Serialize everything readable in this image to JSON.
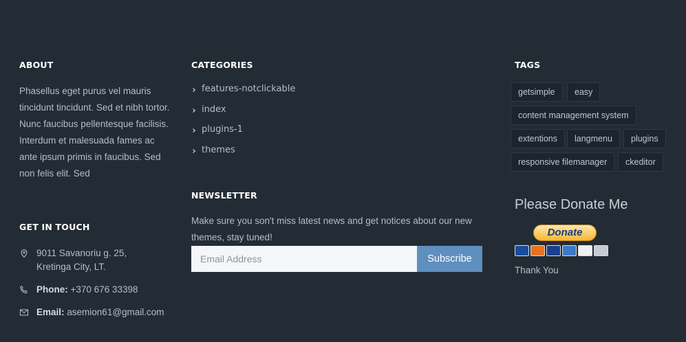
{
  "about": {
    "heading": "ABOUT",
    "text": "Phasellus eget purus vel mauris tincidunt tincidunt. Sed et nibh tortor. Nunc faucibus pellentesque facilisis. Interdum et malesuada fames ac ante ipsum primis in faucibus. Sed non felis elit. Sed"
  },
  "contact": {
    "heading": "GET IN TOUCH",
    "address_line1": "9011 Savanoriu g. 25,",
    "address_line2": "Kretinga City, LT.",
    "phone_label": "Phone:",
    "phone_value": "+370 676 33398",
    "email_label": "Email:",
    "email_value": "asemion61@gmail.com",
    "icons": [
      "map-pin-icon",
      "phone-icon",
      "envelope-icon"
    ]
  },
  "categories": {
    "heading": "CATEGORIES",
    "items": [
      {
        "label": "features-notclickable"
      },
      {
        "label": "index"
      },
      {
        "label": "plugins-1"
      },
      {
        "label": "themes"
      }
    ]
  },
  "newsletter": {
    "heading": "NEWSLETTER",
    "text": "Make sure you son't miss latest news and get notices about our new themes, stay tuned!",
    "input_placeholder": "Email Address",
    "input_value": "",
    "button_label": "Subscribe"
  },
  "tags": {
    "heading": "TAGS",
    "items": [
      {
        "label": "getsimple"
      },
      {
        "label": "easy"
      },
      {
        "label": "content management system"
      },
      {
        "label": "extentions"
      },
      {
        "label": "langmenu"
      },
      {
        "label": "plugins"
      },
      {
        "label": "responsive filemanager"
      },
      {
        "label": "ckeditor"
      }
    ]
  },
  "donate": {
    "title": "Please Donate Me",
    "button_label": "Donate",
    "thanks": "Thank You"
  },
  "colors": {
    "background": "#232b35",
    "accent": "#5f8fbf",
    "heading": "#ffffff"
  }
}
